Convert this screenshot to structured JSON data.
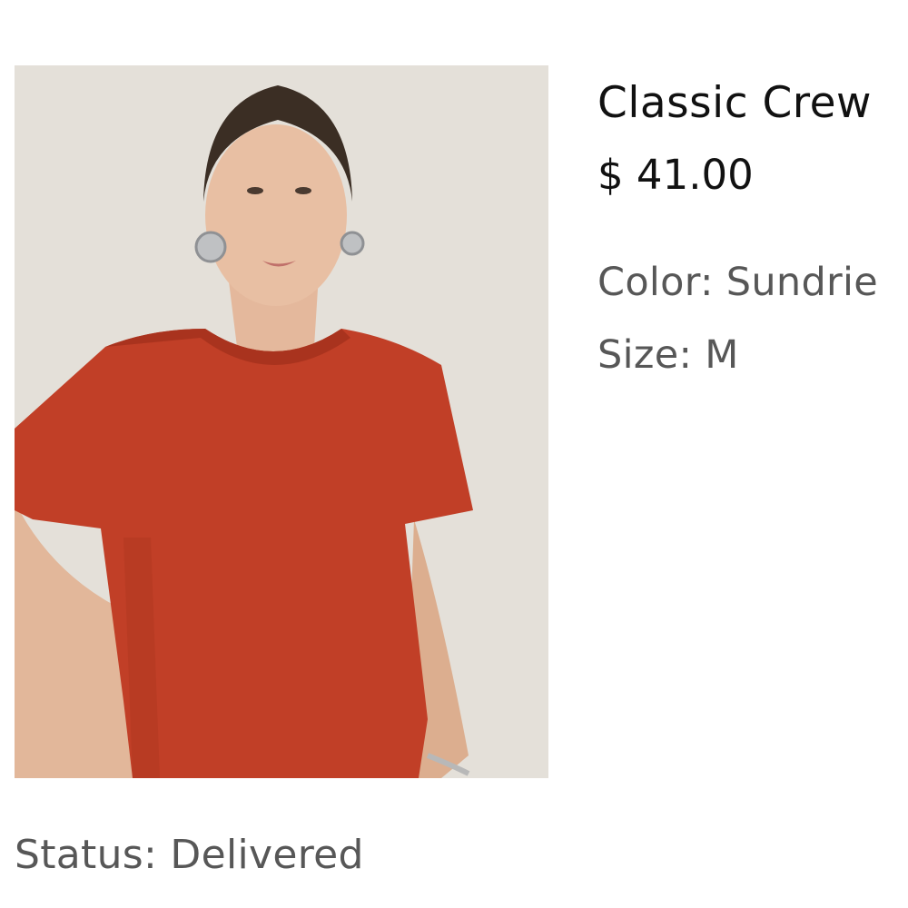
{
  "product": {
    "title": "Classic Crew",
    "price": "$ 41.00",
    "color_label": "Color: Sundrie",
    "size_label": "Size: M",
    "shirt_color": "#c13f27",
    "background_color": "#e7e3dc"
  },
  "order": {
    "status_label": "Status: Delivered"
  }
}
